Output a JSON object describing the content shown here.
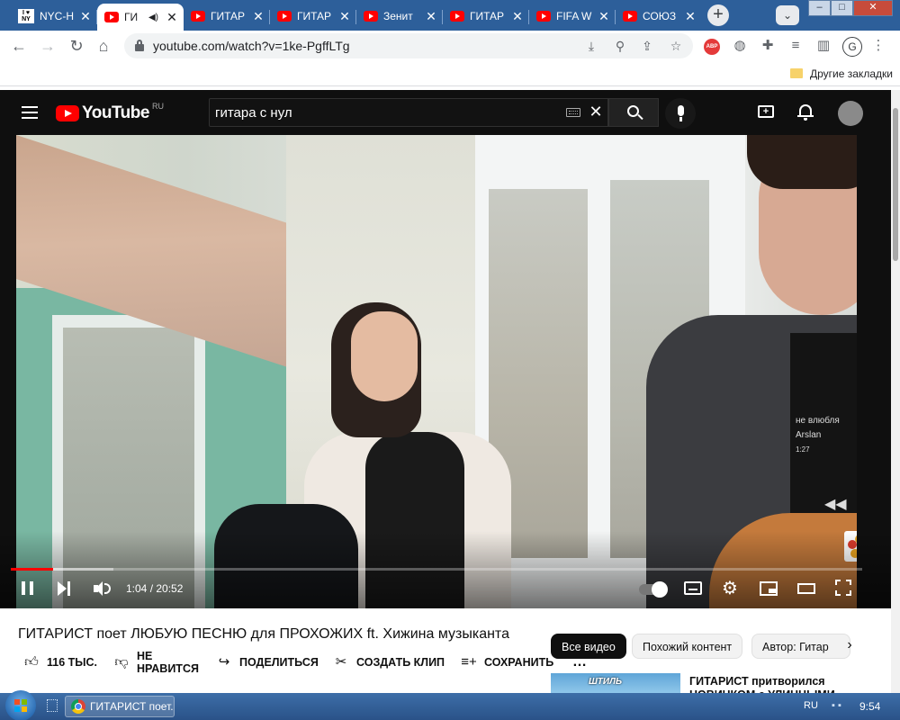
{
  "browser": {
    "tabs": [
      {
        "label": "NYC-H",
        "favicon": "ny-icon"
      },
      {
        "label": "ГИ",
        "favicon": "youtube-icon",
        "active": true,
        "audio": "speaker-icon"
      },
      {
        "label": "ГИТАР",
        "favicon": "youtube-icon"
      },
      {
        "label": "ГИТАР",
        "favicon": "youtube-icon"
      },
      {
        "label": "Зенит",
        "favicon": "youtube-icon"
      },
      {
        "label": "ГИТАР",
        "favicon": "youtube-icon"
      },
      {
        "label": "FIFA W",
        "favicon": "youtube-icon"
      },
      {
        "label": "СОЮЗ",
        "favicon": "youtube-icon"
      }
    ],
    "new_tab": "+",
    "window_buttons": {
      "minimize": "–",
      "maximize": "□",
      "close": "✕"
    },
    "url": "youtube.com/watch?v=1ke-PgffLTg",
    "profile_initial": "G",
    "abp_label": "ABP",
    "bookmarks_other": "Другие закладки"
  },
  "youtube": {
    "logo_text": "YouTube",
    "region": "RU",
    "search_value": "гитара с нул",
    "clear": "✕",
    "player": {
      "time": "1:04 / 20:52",
      "progress_played": 0.05,
      "progress_loaded": 0.12,
      "shirt_text_1": "не влюбля",
      "shirt_text_2": "Arslan",
      "shirt_text_3": "1:27"
    },
    "video_title": "ГИТАРИСТ поет ЛЮБУЮ ПЕСНЮ для ПРОХОЖИХ ft. Хижина музыканта",
    "actions": {
      "like": "116 ТЫС.",
      "dislike_1": "НЕ",
      "dislike_2": "НРАВИТСЯ",
      "share": "ПОДЕЛИТЬСЯ",
      "clip": "СОЗДАТЬ КЛИП",
      "save": "СОХРАНИТЬ",
      "more": "…"
    },
    "chips": [
      "Все видео",
      "Похожий контент",
      "Автор: Гитар"
    ],
    "recommendation": {
      "thumb_badge": "ШТИЛЬ",
      "title": "ГИТАРИСТ притворился НОВИЧКОМ с УЛИЧНЫМИ"
    }
  },
  "taskbar": {
    "task_label": "ГИТАРИСТ поет...",
    "lang": "RU",
    "clock": "9:54"
  },
  "colors": {
    "tabstrip": "#2d5f9a",
    "youtube_red": "#ff0000",
    "yt_dark": "#0f0f0f"
  }
}
